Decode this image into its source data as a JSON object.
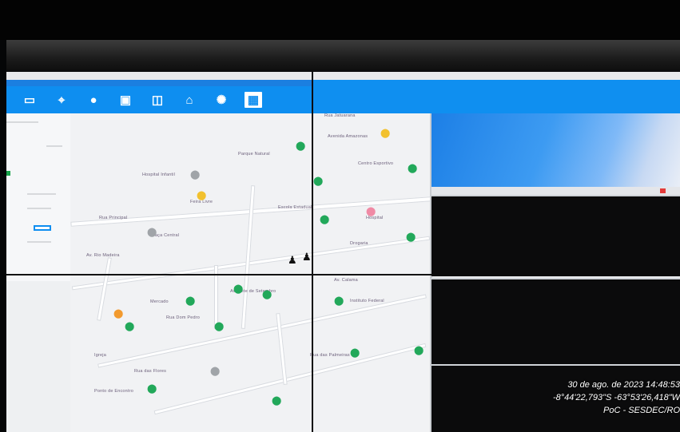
{
  "osd": {
    "datetime": "30 de ago. de 2023 14:48:53",
    "coords": "-8°44'22,793\"S -63°53'26,418\"W",
    "tag": "PoC - SESDEC/RO"
  },
  "toolbar": {
    "icons": [
      "map-icon",
      "crosshair-icon",
      "user-icon",
      "monitor-icon",
      "screen-icon",
      "unlock-icon",
      "gear-icon",
      "grid-icon"
    ]
  },
  "colors": {
    "toolbar_blue": "#0e8ef0",
    "pin_green": "#22a85a",
    "pin_yellow": "#f2c12e"
  }
}
